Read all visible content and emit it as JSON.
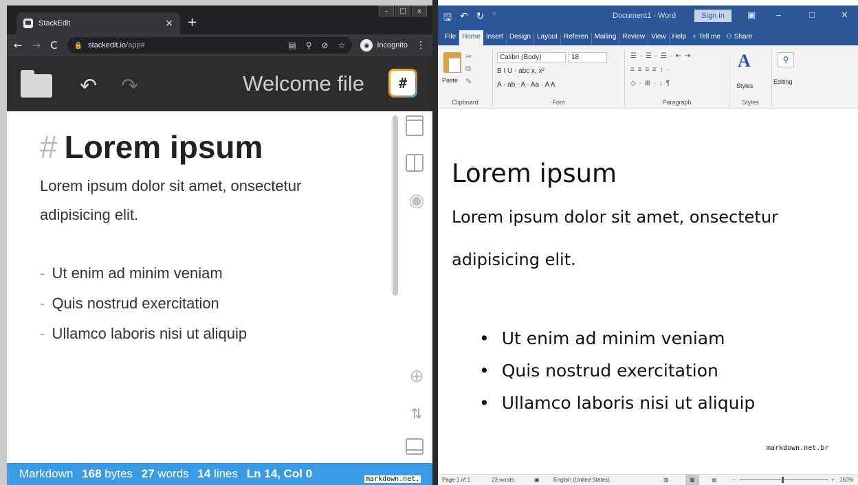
{
  "browser": {
    "tab_title": "StackEdit",
    "tab_close": "×",
    "new_tab": "+",
    "url_host": "stackedit.io",
    "url_path": "/app#",
    "incognito_label": "Incognito",
    "window_controls": [
      "–",
      "□",
      "x"
    ]
  },
  "stackedit": {
    "file_title": "Welcome file",
    "markdown_button": "#",
    "content": {
      "heading_hash": "#",
      "heading": "Lorem ipsum",
      "paragraph": "Lorem ipsum dolor sit amet, onsectetur adipisicing elit.",
      "list_marker": "-",
      "list_items": [
        "Ut enim ad minim veniam",
        "Quis nostrud exercitation",
        "Ullamco laboris nisi ut aliquip"
      ]
    },
    "status": {
      "mode": "Markdown",
      "bytes_value": "168",
      "bytes_label": "bytes",
      "words_value": "27",
      "words_label": "words",
      "lines_value": "14",
      "lines_label": "lines",
      "cursor": "Ln 14, Col 0"
    },
    "watermark": "markdown.net."
  },
  "word": {
    "doc_title": "Document1  -  Word",
    "sign_in": "Sign in",
    "tabs": [
      "File",
      "Home",
      "Insert",
      "Design",
      "Layout",
      "Referen",
      "Mailing",
      "Review",
      "View",
      "Help",
      "Tell me",
      "Share"
    ],
    "ribbon": {
      "paste_label": "Paste",
      "clipboard_label": "Clipboard",
      "font_name": "Calibri (Body)",
      "font_size": "18",
      "font_label": "Font",
      "paragraph_label": "Paragraph",
      "styles_button": "Styles",
      "styles_label": "Styles",
      "editing_label": "Editing",
      "format_row1": "B  I  U  ·  abc  x,  x²",
      "format_row2": "A  ·  ab  ·  A  ·  Aa  ·   A  A"
    },
    "content": {
      "heading": "Lorem ipsum",
      "paragraph": "Lorem ipsum dolor sit amet, onsectetur adipisicing elit.",
      "list_items": [
        "Ut enim ad minim veniam",
        "Quis nostrud exercitation",
        "Ullamco laboris nisi ut aliquip"
      ]
    },
    "watermark": "markdown.net.br",
    "status": {
      "page": "Page 1 of 1",
      "words": "23 words",
      "language": "English (United States)",
      "zoom_minus": "–",
      "zoom_plus": "+",
      "zoom": "150%"
    }
  },
  "colors": {
    "stackedit_status": "#3a9ae4",
    "stackedit_nav": "#2c2c2c",
    "word_brand": "#2b579a"
  }
}
